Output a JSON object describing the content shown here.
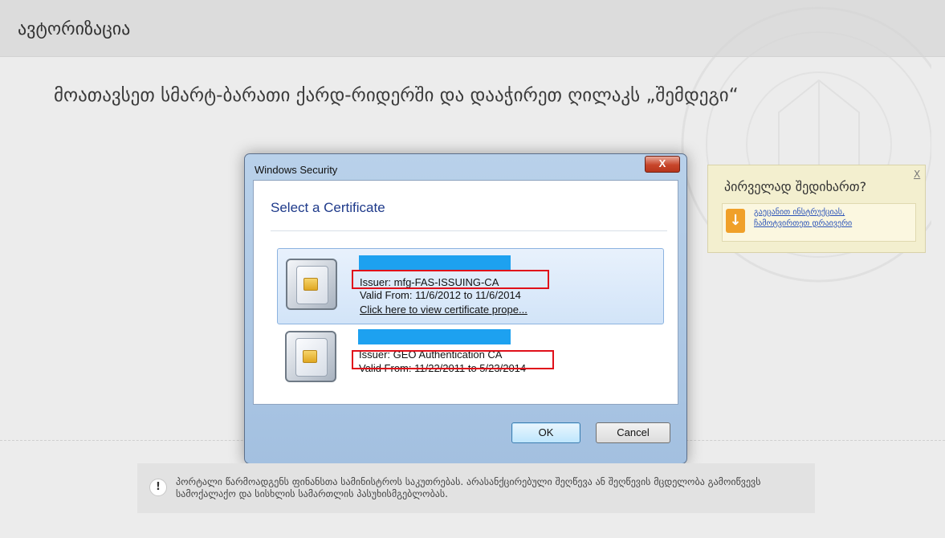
{
  "header": {
    "title": "ავტორიზაცია"
  },
  "instruction": "მოათავსეთ სმარტ-ბარათი ქარდ-რიდერში და დააჭირეთ ღილაკს „შემდეგი“",
  "dialog": {
    "window_title": "Windows Security",
    "close_label": "X",
    "heading": "Select a Certificate",
    "certificates": [
      {
        "issuer": "Issuer: mfg-FAS-ISSUING-CA",
        "valid": "Valid From: 11/6/2012 to 11/6/2014",
        "link": "Click here to view certificate prope...",
        "selected": true
      },
      {
        "issuer": "Issuer: GEO Authentication CA",
        "valid": "Valid From: 11/22/2011 to 5/23/2014",
        "selected": false
      }
    ],
    "ok_label": "OK",
    "cancel_label": "Cancel"
  },
  "help": {
    "question": "პირველად შედიხართ?",
    "close": "X",
    "download_line1": "გაეცანით ინსტრუქციას,",
    "download_line2": "ჩამოტვირთეთ დრაივერი",
    "icon": "download-arrow-icon"
  },
  "notice": {
    "icon": "exclamation-icon",
    "text": "პორტალი წარმოადგენს ფინანსთა სამინისტროს საკუთრებას. არასანქცირებული შეღწევა ან შეღწევის მცდელობა გამოიწვევს სამოქალაქო და სისხლის სამართლის პასუხისმგებლობას."
  },
  "colors": {
    "highlight_blue": "#1da1f0",
    "annotation_red": "#e0101a",
    "help_bg": "#f3efcf"
  }
}
